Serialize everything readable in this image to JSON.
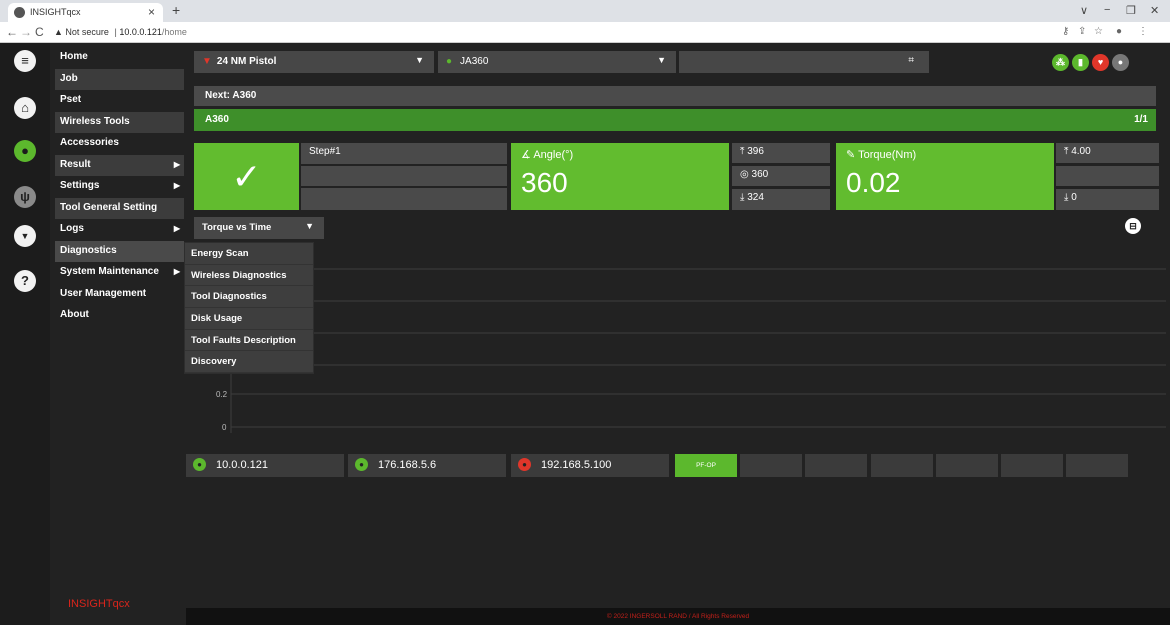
{
  "browser": {
    "tab_title": "INSIGHTqcx",
    "tab_close": "×",
    "new_tab": "+",
    "warning": "▲ Not secure",
    "separator": "|",
    "host": "10.0.0.121",
    "path": "/home",
    "back": "←",
    "forward": "→",
    "reload": "C",
    "minimize": "−",
    "restore": "❐",
    "close": "✕",
    "chevron": "∨",
    "key_icon": "⚷",
    "share_icon": "⇪",
    "star_icon": "☆",
    "profile_icon": "●",
    "more_icon": "⋮"
  },
  "sidebar": {
    "rail_icons": [
      {
        "name": "menu-icon",
        "glyph": "≡"
      },
      {
        "name": "home-icon",
        "glyph": "⌂"
      },
      {
        "name": "user-icon",
        "glyph": "●"
      },
      {
        "name": "usb-icon",
        "glyph": "ψ"
      },
      {
        "name": "download-icon",
        "glyph": "▼"
      },
      {
        "name": "help-icon",
        "glyph": "?"
      }
    ],
    "items": [
      {
        "label": "Home"
      },
      {
        "label": "Job"
      },
      {
        "label": "Pset"
      },
      {
        "label": "Wireless Tools"
      },
      {
        "label": "Accessories"
      },
      {
        "label": "Result"
      },
      {
        "label": "Settings"
      },
      {
        "label": "Tool General Setting"
      },
      {
        "label": "Logs"
      },
      {
        "label": "Diagnostics"
      },
      {
        "label": "System Maintenance"
      },
      {
        "label": "User Management"
      },
      {
        "label": "About"
      }
    ],
    "submenu": [
      "Energy Scan",
      "Wireless Diagnostics",
      "Tool Diagnostics",
      "Disk Usage",
      "Tool Faults Description",
      "Discovery"
    ],
    "brand": "INSIGHTqcx"
  },
  "top": {
    "tool_select": "24 NM Pistol",
    "job_select": "JA360",
    "status_colors": [
      "#5cb82d",
      "#5cb82d",
      "#e0362a",
      "#777777"
    ]
  },
  "job": {
    "next_label": "Next: A360",
    "current": "A360",
    "count": "1/1"
  },
  "result": {
    "ok_icon": "✓",
    "step": "Step#1",
    "angle_label": "Angle(°)",
    "angle_value": "360",
    "angle_high": "396",
    "angle_target": "360",
    "angle_low": "324",
    "torque_label": "Torque(Nm)",
    "torque_value": "0.02",
    "torque_high": "4.00",
    "torque_low": "0"
  },
  "graph": {
    "select": "Torque vs Time",
    "tick_02": "0.2",
    "tick_0": "0"
  },
  "network": {
    "ip1": "10.0.0.121",
    "ip2": "176.168.5.6",
    "ip3": "192.168.5.100",
    "pfop": "PF-OP"
  },
  "footer": "© 2022 INGERSOLL RAND / All Rights Reserved",
  "accent": "#62bc2f"
}
